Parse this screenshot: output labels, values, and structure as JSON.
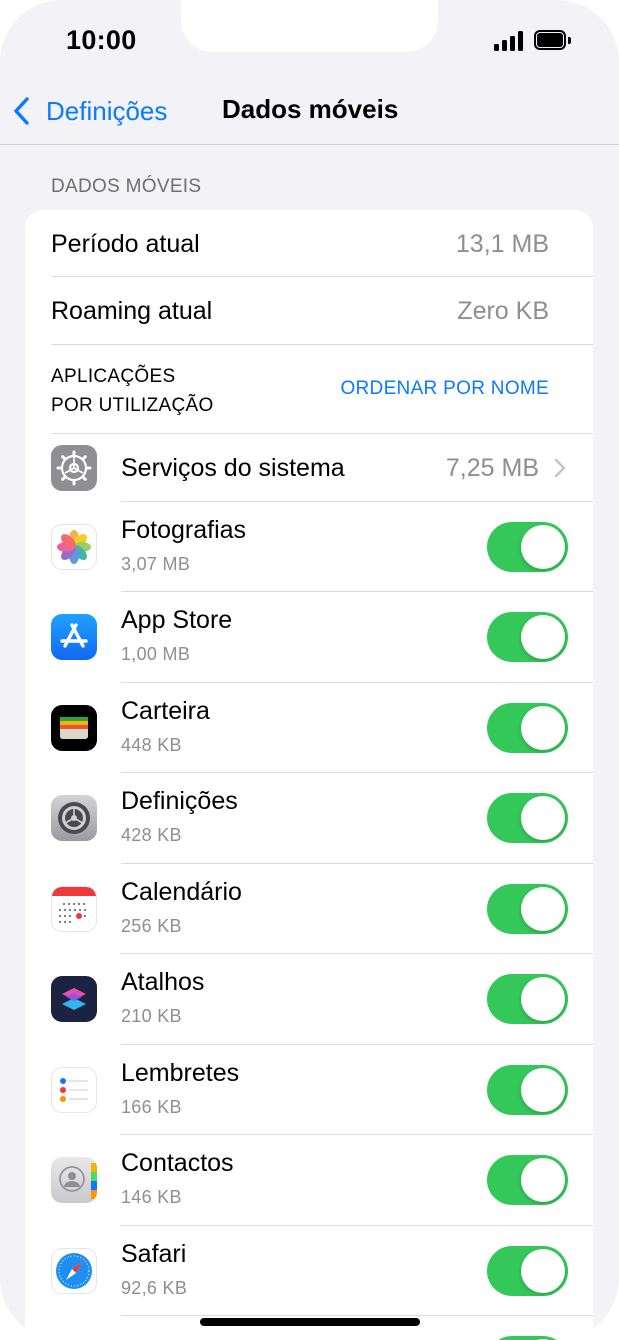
{
  "status": {
    "time": "10:00"
  },
  "nav": {
    "back_label": "Definições",
    "title": "Dados móveis"
  },
  "section_header": "DADOS MÓVEIS",
  "summary": [
    {
      "label": "Período atual",
      "value": "13,1 MB"
    },
    {
      "label": "Roaming atual",
      "value": "Zero KB"
    }
  ],
  "apps_header": {
    "line1": "APLICAÇÕES",
    "line2": "POR UTILIZAÇÃO",
    "sort_label": "ORDENAR POR NOME"
  },
  "system_services": {
    "label": "Serviços do sistema",
    "value": "7,25 MB"
  },
  "apps": [
    {
      "name": "Fotografias",
      "usage": "3,07 MB",
      "icon": "photos-icon",
      "enabled": true
    },
    {
      "name": "App Store",
      "usage": "1,00 MB",
      "icon": "app-store-icon",
      "enabled": true
    },
    {
      "name": "Carteira",
      "usage": "448 KB",
      "icon": "wallet-icon",
      "enabled": true
    },
    {
      "name": "Definições",
      "usage": "428 KB",
      "icon": "settings-icon",
      "enabled": true
    },
    {
      "name": "Calendário",
      "usage": "256 KB",
      "icon": "calendar-icon",
      "enabled": true
    },
    {
      "name": "Atalhos",
      "usage": "210 KB",
      "icon": "shortcuts-icon",
      "enabled": true
    },
    {
      "name": "Lembretes",
      "usage": "166 KB",
      "icon": "reminders-icon",
      "enabled": true
    },
    {
      "name": "Contactos",
      "usage": "146 KB",
      "icon": "contacts-icon",
      "enabled": true
    },
    {
      "name": "Safari",
      "usage": "92,6 KB",
      "icon": "safari-icon",
      "enabled": true
    }
  ],
  "colors": {
    "accent": "#0a7aff",
    "toggle_on": "#34c759",
    "background": "#f2f2f7",
    "secondary_text": "#8e8e93"
  }
}
